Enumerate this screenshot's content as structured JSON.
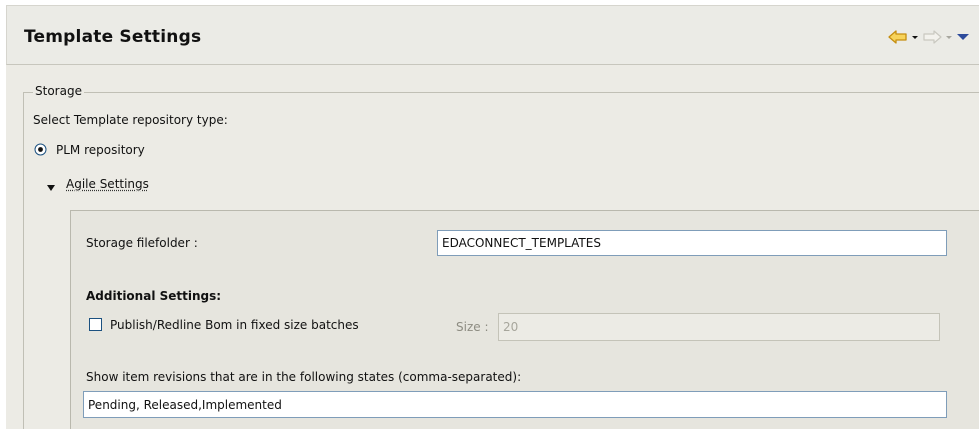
{
  "header": {
    "title": "Template Settings"
  },
  "nav": {
    "back_icon": "back-arrow-icon",
    "back_menu_icon": "dropdown-icon",
    "forward_icon": "forward-arrow-icon",
    "forward_menu_icon": "dropdown-icon",
    "view_menu_icon": "view-menu-icon",
    "colors": {
      "back": "#e8b21e",
      "forward_disabled": "#c9c8c0",
      "view_menu": "#2d4b9b"
    }
  },
  "storage": {
    "group_label": "Storage",
    "select_label": "Select Template repository type:",
    "radio_label": "PLM repository",
    "radio_checked": true,
    "section_label": "Agile Settings",
    "storage_filefolder_label": "Storage filefolder :",
    "storage_filefolder_value": "EDACONNECT_TEMPLATES",
    "additional_settings_label": "Additional Settings:",
    "publish_checkbox_label": "Publish/Redline Bom in fixed size batches",
    "publish_checked": false,
    "size_label": "Size :",
    "size_value": "20",
    "states_label": "Show item revisions that are in the following states (comma-separated):",
    "states_value": "Pending, Released,Implemented"
  }
}
